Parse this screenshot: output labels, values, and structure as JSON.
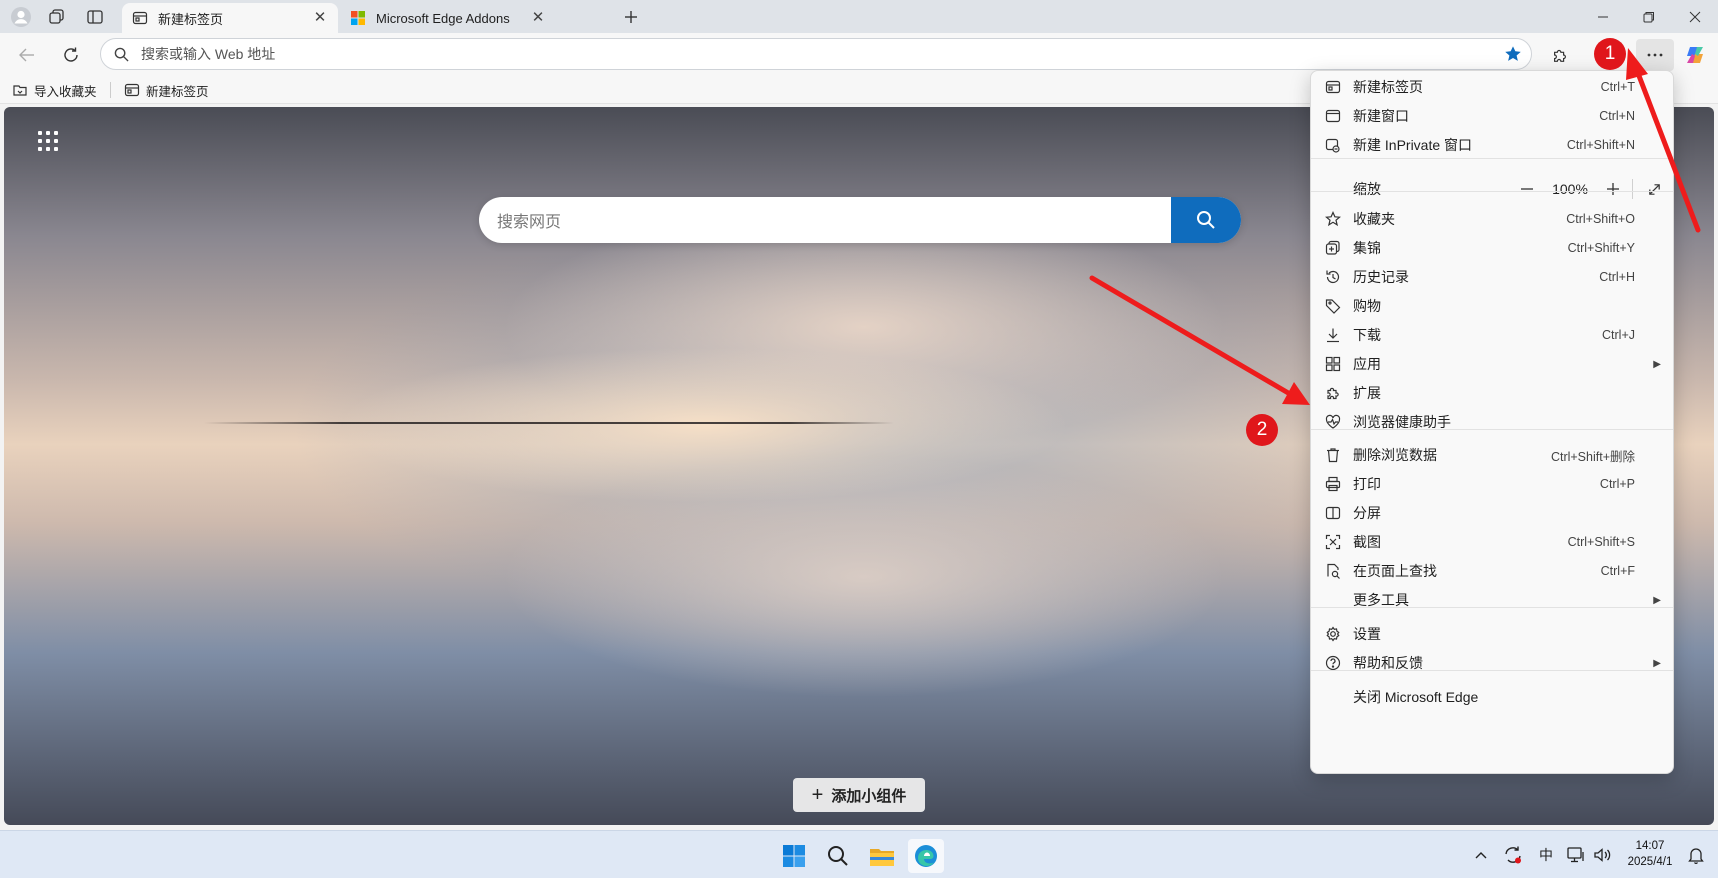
{
  "tabs": [
    {
      "title": "新建标签页",
      "active": true
    },
    {
      "title": "Microsoft Edge Addons",
      "active": false
    }
  ],
  "address_bar": {
    "placeholder": "搜索或输入 Web 地址"
  },
  "favorites_bar": [
    {
      "label": "导入收藏夹"
    },
    {
      "label": "新建标签页"
    }
  ],
  "new_tab_page": {
    "search_placeholder": "搜索网页",
    "add_widget_label": "添加小组件"
  },
  "annotations": {
    "badge1": "1",
    "badge2": "2",
    "color": "#e0161b"
  },
  "menu": {
    "items": [
      {
        "id": "new_tab",
        "label": "新建标签页",
        "shortcut": "Ctrl+T",
        "icon": "new-tab-icon"
      },
      {
        "id": "new_window",
        "label": "新建窗口",
        "shortcut": "Ctrl+N",
        "icon": "window-icon"
      },
      {
        "id": "new_inprivate",
        "label": "新建 InPrivate 窗口",
        "shortcut": "Ctrl+Shift+N",
        "icon": "inprivate-icon"
      },
      {
        "id": "favorites",
        "label": "收藏夹",
        "shortcut": "Ctrl+Shift+O",
        "icon": "favorites-icon"
      },
      {
        "id": "collections",
        "label": "集锦",
        "shortcut": "Ctrl+Shift+Y",
        "icon": "collections-icon"
      },
      {
        "id": "history",
        "label": "历史记录",
        "shortcut": "Ctrl+H",
        "icon": "history-icon"
      },
      {
        "id": "shopping",
        "label": "购物",
        "shortcut": "",
        "icon": "tag-icon"
      },
      {
        "id": "downloads",
        "label": "下载",
        "shortcut": "Ctrl+J",
        "icon": "download-icon"
      },
      {
        "id": "apps",
        "label": "应用",
        "shortcut": "",
        "icon": "apps-icon"
      },
      {
        "id": "extensions",
        "label": "扩展",
        "shortcut": "",
        "icon": "puzzle-icon"
      },
      {
        "id": "health",
        "label": "浏览器健康助手",
        "shortcut": "",
        "icon": "heart-pulse-icon"
      },
      {
        "id": "clear",
        "label": "删除浏览数据",
        "shortcut": "Ctrl+Shift+删除",
        "icon": "trash-icon"
      },
      {
        "id": "print",
        "label": "打印",
        "shortcut": "Ctrl+P",
        "icon": "printer-icon"
      },
      {
        "id": "split",
        "label": "分屏",
        "shortcut": "",
        "icon": "split-screen-icon"
      },
      {
        "id": "screenshot",
        "label": "截图",
        "shortcut": "Ctrl+Shift+S",
        "icon": "screenshot-icon"
      },
      {
        "id": "find",
        "label": "在页面上查找",
        "shortcut": "Ctrl+F",
        "icon": "find-on-page-icon"
      },
      {
        "id": "more_tools",
        "label": "更多工具",
        "shortcut": "",
        "icon": ""
      },
      {
        "id": "settings",
        "label": "设置",
        "shortcut": "",
        "icon": "gear-icon"
      },
      {
        "id": "help",
        "label": "帮助和反馈",
        "shortcut": "",
        "icon": "help-icon"
      },
      {
        "id": "close_edge",
        "label": "关闭 Microsoft Edge",
        "shortcut": "",
        "icon": ""
      }
    ],
    "zoom": {
      "label": "缩放",
      "value": "100%",
      "minus": "—",
      "plus": "+"
    }
  },
  "taskbar": {
    "tray_ime": "中",
    "time": "14:07",
    "date": "2025/4/1"
  }
}
